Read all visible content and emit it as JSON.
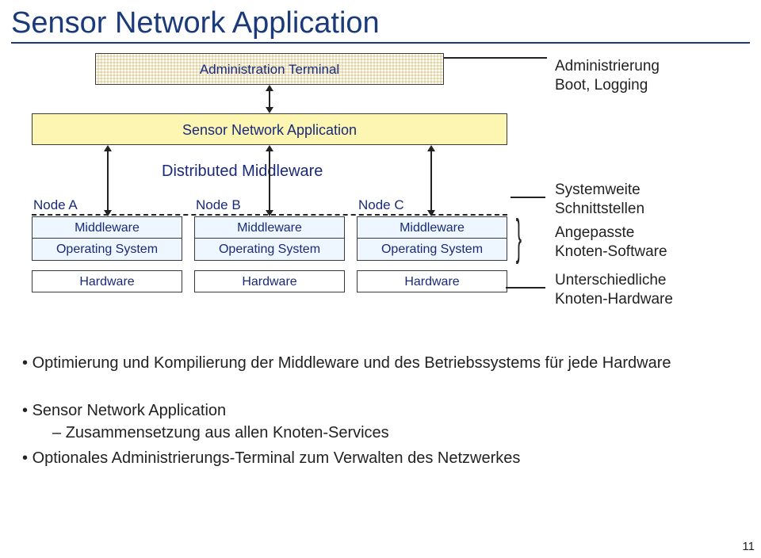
{
  "title": "Sensor Network Application",
  "boxes": {
    "admin": "Administration Terminal",
    "app": "Sensor Network Application",
    "dmw": "Distributed Middleware",
    "node_labels": [
      "Node A",
      "Node B",
      "Node C"
    ],
    "mw": "Middleware",
    "os": "Operating System",
    "hw": "Hardware"
  },
  "annotations": {
    "a1": "Administrierung\nBoot, Logging",
    "a2": "Systemweite\nSchnittstellen",
    "a3": "Angepasste\nKnoten-Software",
    "a4": "Unterschiedliche\nKnoten-Hardware"
  },
  "bullets": {
    "b1": "Optimierung und Kompilierung der Middleware und des Betriebssystems für jede Hardware",
    "b2": "Sensor Network Application",
    "s1": "Zusammensetzung aus allen Knoten-Services",
    "b3": "Optionales Administrierungs-Terminal zum Verwalten des Netzwerkes"
  },
  "page": "11"
}
